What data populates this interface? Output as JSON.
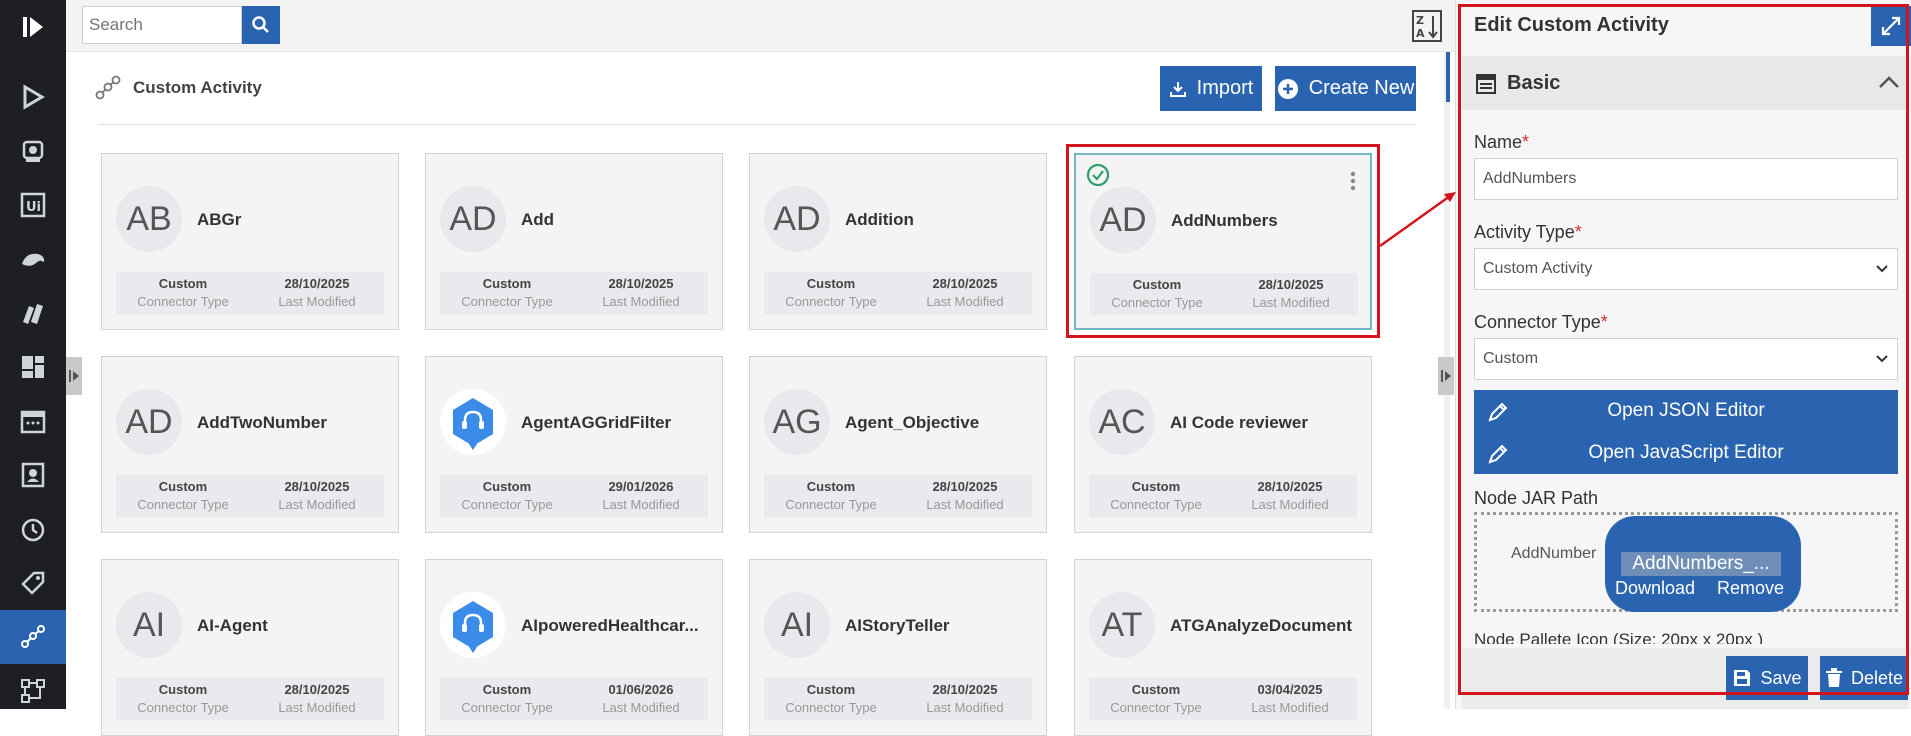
{
  "nav": {
    "items": [
      "play-logo-icon",
      "play-icon",
      "robot-icon",
      "ui-icon",
      "chameleon-icon",
      "books-icon",
      "dashboard-icon",
      "calendar-icon",
      "contact-icon",
      "alarm-icon",
      "tag-icon",
      "custom-activity-icon",
      "flow-icon"
    ]
  },
  "search": {
    "placeholder": "Search"
  },
  "section": {
    "title": "Custom Activity"
  },
  "toolbar": {
    "import_label": "Import",
    "create_label": "Create New"
  },
  "cards": [
    {
      "initials": "AB",
      "name": "ABGr",
      "type": "Custom",
      "type_key": "Connector Type",
      "date": "28/10/2025",
      "date_key": "Last Modified"
    },
    {
      "initials": "AD",
      "name": "Add",
      "type": "Custom",
      "type_key": "Connector Type",
      "date": "28/10/2025",
      "date_key": "Last Modified"
    },
    {
      "initials": "AD",
      "name": "Addition",
      "type": "Custom",
      "type_key": "Connector Type",
      "date": "28/10/2025",
      "date_key": "Last Modified"
    },
    {
      "initials": "AD",
      "name": "AddNumbers",
      "type": "Custom",
      "type_key": "Connector Type",
      "date": "28/10/2025",
      "date_key": "Last Modified"
    },
    {
      "initials": "AD",
      "name": "AddTwoNumber",
      "type": "Custom",
      "type_key": "Connector Type",
      "date": "28/10/2025",
      "date_key": "Last Modified"
    },
    {
      "initials": "",
      "name": "AgentAGGridFilter",
      "type": "Custom",
      "type_key": "Connector Type",
      "date": "29/01/2026",
      "date_key": "Last Modified"
    },
    {
      "initials": "AG",
      "name": "Agent_Objective",
      "type": "Custom",
      "type_key": "Connector Type",
      "date": "28/10/2025",
      "date_key": "Last Modified"
    },
    {
      "initials": "AC",
      "name": "AI Code reviewer",
      "type": "Custom",
      "type_key": "Connector Type",
      "date": "28/10/2025",
      "date_key": "Last Modified"
    },
    {
      "initials": "AI",
      "name": "AI-Agent",
      "type": "Custom",
      "type_key": "Connector Type",
      "date": "28/10/2025",
      "date_key": "Last Modified"
    },
    {
      "initials": "",
      "name": "AIpoweredHealthcar...",
      "type": "Custom",
      "type_key": "Connector Type",
      "date": "01/06/2026",
      "date_key": "Last Modified"
    },
    {
      "initials": "AI",
      "name": "AIStoryTeller",
      "type": "Custom",
      "type_key": "Connector Type",
      "date": "28/10/2025",
      "date_key": "Last Modified"
    },
    {
      "initials": "AT",
      "name": "ATGAnalyzeDocument",
      "type": "Custom",
      "type_key": "Connector Type",
      "date": "03/04/2025",
      "date_key": "Last Modified"
    }
  ],
  "panel": {
    "title": "Edit Custom Activity",
    "section_label": "Basic",
    "name_label": "Name",
    "name_value": "AddNumbers",
    "activity_type_label": "Activity Type",
    "activity_type_value": "Custom Activity",
    "connector_type_label": "Connector Type",
    "connector_type_value": "Custom",
    "json_editor_label": "Open JSON Editor",
    "js_editor_label": "Open JavaScript Editor",
    "jar_label": "Node JAR Path",
    "jar_name": "AddNumber",
    "file_name": "AddNumbers_...",
    "download_label": "Download",
    "remove_label": "Remove",
    "next_label": "Node Pallete Icon (Size: 20px x 20px )",
    "save_label": "Save",
    "delete_label": "Delete",
    "required_mark": "*"
  },
  "colors": {
    "accent": "#2a64b0",
    "nav_bg": "#1e1f24",
    "annotation": "#d3141c",
    "check": "#2e9e6b"
  }
}
